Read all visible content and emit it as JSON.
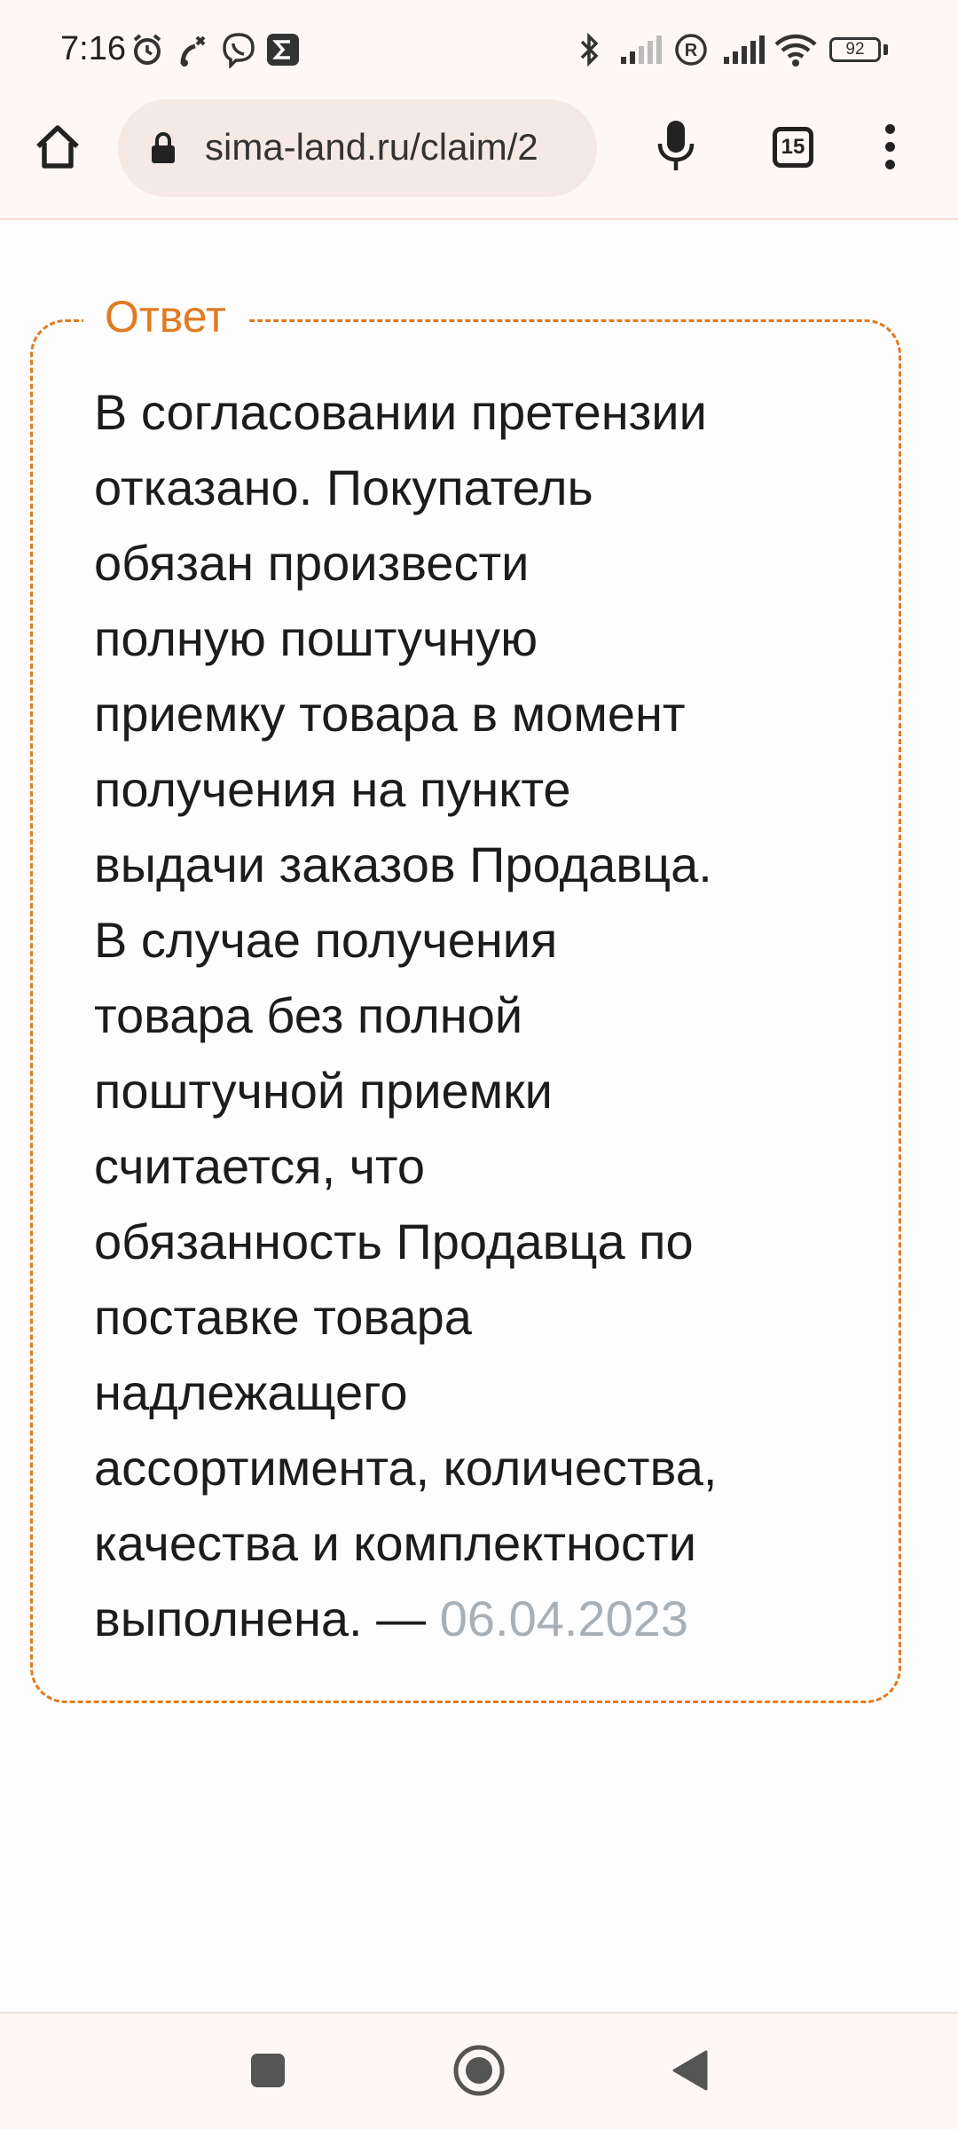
{
  "status_bar": {
    "time": "7:16",
    "battery": "92",
    "icons": [
      "alarm-icon",
      "missed-call-icon",
      "viber-icon",
      "sigma-app-icon",
      "bluetooth-icon",
      "signal-1-icon",
      "roaming-r-icon",
      "signal-2-icon",
      "wifi-icon",
      "battery-icon"
    ]
  },
  "browser": {
    "url": "sima-land.ru/claim/2",
    "tab_count": "15",
    "icons": [
      "home-icon",
      "lock-icon",
      "mic-icon",
      "tabs-icon",
      "more-vert-icon"
    ]
  },
  "answer": {
    "legend": "Ответ",
    "lines": [
      "В согласовании претензии",
      "отказано. Покупатель",
      "обязан произвести",
      "полную поштучную",
      "приемку товара в момент",
      "получения на пункте",
      "выдачи заказов Продавца.",
      "В случае получения",
      "товара без полной",
      "поштучной приемки",
      "считается, что",
      "обязанность Продавца по",
      "поставке товара",
      "надлежащего",
      "ассортимента, количества,",
      "качества и комплектности"
    ],
    "last_line": "выполнена. —",
    "date": "06.04.2023"
  },
  "colors": {
    "accent": "#e07b20",
    "date_gray": "#a8b0b7",
    "text": "#1c1c1c",
    "bar_background": "#fdf8f6"
  },
  "nav_bar": {
    "icons": [
      "recents-square-icon",
      "home-circle-icon",
      "back-triangle-icon"
    ]
  }
}
